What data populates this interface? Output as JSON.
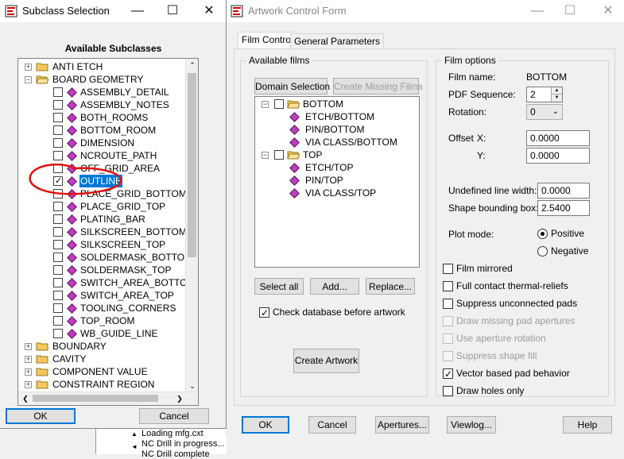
{
  "subclass_dialog": {
    "title": "Subclass Selection",
    "heading": "Available Subclasses",
    "tree": [
      {
        "label": "ANTI ETCH",
        "type": "folder",
        "expanded": false,
        "level": 0
      },
      {
        "label": "BOARD GEOMETRY",
        "type": "folder",
        "expanded": true,
        "level": 0
      },
      {
        "label": "ASSEMBLY_DETAIL",
        "type": "item",
        "checked": false,
        "level": 1
      },
      {
        "label": "ASSEMBLY_NOTES",
        "type": "item",
        "checked": false,
        "level": 1
      },
      {
        "label": "BOTH_ROOMS",
        "type": "item",
        "checked": false,
        "level": 1
      },
      {
        "label": "BOTTOM_ROOM",
        "type": "item",
        "checked": false,
        "level": 1
      },
      {
        "label": "DIMENSION",
        "type": "item",
        "checked": false,
        "level": 1
      },
      {
        "label": "NCROUTE_PATH",
        "type": "item",
        "checked": false,
        "level": 1
      },
      {
        "label": "OFF_GRID_AREA",
        "type": "item",
        "checked": false,
        "level": 1
      },
      {
        "label": "OUTLINE",
        "type": "item",
        "checked": true,
        "selected": true,
        "level": 1
      },
      {
        "label": "PLACE_GRID_BOTTOM",
        "type": "item",
        "checked": false,
        "level": 1
      },
      {
        "label": "PLACE_GRID_TOP",
        "type": "item",
        "checked": false,
        "level": 1
      },
      {
        "label": "PLATING_BAR",
        "type": "item",
        "checked": false,
        "level": 1
      },
      {
        "label": "SILKSCREEN_BOTTOM",
        "type": "item",
        "checked": false,
        "level": 1
      },
      {
        "label": "SILKSCREEN_TOP",
        "type": "item",
        "checked": false,
        "level": 1
      },
      {
        "label": "SOLDERMASK_BOTTOM",
        "type": "item",
        "checked": false,
        "level": 1
      },
      {
        "label": "SOLDERMASK_TOP",
        "type": "item",
        "checked": false,
        "level": 1
      },
      {
        "label": "SWITCH_AREA_BOTTOM",
        "type": "item",
        "checked": false,
        "level": 1
      },
      {
        "label": "SWITCH_AREA_TOP",
        "type": "item",
        "checked": false,
        "level": 1
      },
      {
        "label": "TOOLING_CORNERS",
        "type": "item",
        "checked": false,
        "level": 1
      },
      {
        "label": "TOP_ROOM",
        "type": "item",
        "checked": false,
        "level": 1
      },
      {
        "label": "WB_GUIDE_LINE",
        "type": "item",
        "checked": false,
        "level": 1
      },
      {
        "label": "BOUNDARY",
        "type": "folder",
        "expanded": false,
        "level": 0
      },
      {
        "label": "CAVITY",
        "type": "folder",
        "expanded": false,
        "level": 0
      },
      {
        "label": "COMPONENT VALUE",
        "type": "folder",
        "expanded": false,
        "level": 0
      },
      {
        "label": "CONSTRAINT REGION",
        "type": "folder",
        "expanded": false,
        "level": 0
      }
    ],
    "ok_label": "OK",
    "cancel_label": "Cancel"
  },
  "artwork_form": {
    "title": "Artwork Control Form",
    "tabs": [
      "Film Control",
      "General Parameters"
    ],
    "available_films_label": "Available films",
    "domain_selection_label": "Domain Selection",
    "create_missing_films_label": "Create Missing Films",
    "films_tree": [
      {
        "label": "BOTTOM",
        "type": "folder",
        "level": 0
      },
      {
        "label": "ETCH/BOTTOM",
        "type": "item",
        "level": 1
      },
      {
        "label": "PIN/BOTTOM",
        "type": "item",
        "level": 1
      },
      {
        "label": "VIA CLASS/BOTTOM",
        "type": "item",
        "level": 1
      },
      {
        "label": "TOP",
        "type": "folder",
        "level": 0
      },
      {
        "label": "ETCH/TOP",
        "type": "item",
        "level": 1
      },
      {
        "label": "PIN/TOP",
        "type": "item",
        "level": 1
      },
      {
        "label": "VIA CLASS/TOP",
        "type": "item",
        "level": 1
      }
    ],
    "select_all_label": "Select all",
    "add_label": "Add...",
    "replace_label": "Replace...",
    "check_db_label": "Check database before artwork",
    "check_db_checked": true,
    "create_artwork_label": "Create Artwork",
    "film_options": {
      "group_label": "Film options",
      "film_name_label": "Film name:",
      "film_name_value": "BOTTOM",
      "pdf_sequence_label": "PDF Sequence:",
      "pdf_sequence_value": "2",
      "rotation_label": "Rotation:",
      "rotation_value": "0",
      "offset_label": "Offset",
      "offset_x_label": "X:",
      "offset_x_value": "0.0000",
      "offset_y_label": "Y:",
      "offset_y_value": "0.0000",
      "undefined_line_width_label": "Undefined line width:",
      "undefined_line_width_value": "0.0000",
      "shape_bounding_box_label": "Shape bounding box:",
      "shape_bounding_box_value": "2.5400",
      "plot_mode_label": "Plot mode:",
      "positive_label": "Positive",
      "negative_label": "Negative",
      "plot_mode_selected": "Positive",
      "checkboxes": [
        {
          "label": "Film mirrored",
          "checked": false,
          "enabled": true
        },
        {
          "label": "Full contact thermal-reliefs",
          "checked": false,
          "enabled": true
        },
        {
          "label": "Suppress unconnected pads",
          "checked": false,
          "enabled": true
        },
        {
          "label": "Draw missing pad apertures",
          "checked": false,
          "enabled": false
        },
        {
          "label": "Use aperture rotation",
          "checked": false,
          "enabled": false
        },
        {
          "label": "Suppress shape fill",
          "checked": false,
          "enabled": false
        },
        {
          "label": "Vector based pad behavior",
          "checked": true,
          "enabled": true
        },
        {
          "label": "Draw holes only",
          "checked": false,
          "enabled": true
        }
      ]
    },
    "footer": {
      "ok_label": "OK",
      "cancel_label": "Cancel",
      "apertures_label": "Apertures...",
      "viewlog_label": "Viewlog...",
      "help_label": "Help"
    }
  },
  "log_lines": [
    "Loading mfg.cxt",
    "NC Drill in progress...",
    "NC Drill complete"
  ],
  "colors": {
    "selection": "#0078d7",
    "annotation": "#e01010",
    "subclass_icon": "#c03cc0"
  }
}
